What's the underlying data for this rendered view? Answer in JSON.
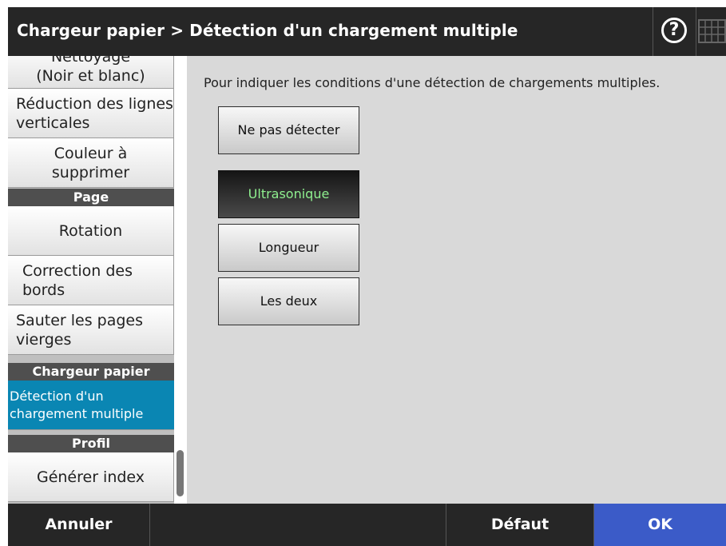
{
  "header": {
    "title": "Chargeur papier > Détection d'un chargement multiple",
    "help_symbol": "?",
    "help_icon": "question-circle-icon",
    "keyboard_icon": "keyboard-icon"
  },
  "sidebar": {
    "items": [
      {
        "label": "Nettoyage\n(Noir et blanc)"
      },
      {
        "label": "Réduction des lignes verticales"
      },
      {
        "label": "Couleur à supprimer"
      },
      {
        "section": "Page"
      },
      {
        "label": "Rotation"
      },
      {
        "label": "Correction des bords"
      },
      {
        "label": "Sauter les pages vierges"
      },
      {
        "section": "Chargeur papier"
      },
      {
        "label": "Détection d'un chargement multiple",
        "selected": true
      },
      {
        "section": "Profil"
      },
      {
        "label": "Générer index"
      }
    ]
  },
  "main": {
    "description": "Pour indiquer les conditions d'une détection de chargements multiples.",
    "options": [
      {
        "label": "Ne pas détecter",
        "selected": false
      },
      {
        "label": "Ultrasonique",
        "selected": true
      },
      {
        "label": "Longueur",
        "selected": false
      },
      {
        "label": "Les deux",
        "selected": false
      }
    ]
  },
  "footer": {
    "cancel": "Annuler",
    "default": "Défaut",
    "ok": "OK"
  },
  "colors": {
    "header_bg": "#262626",
    "selected_sidebar": "#0a86b3",
    "ok_button": "#3b5bc8",
    "active_option_text": "#8ff08f"
  }
}
